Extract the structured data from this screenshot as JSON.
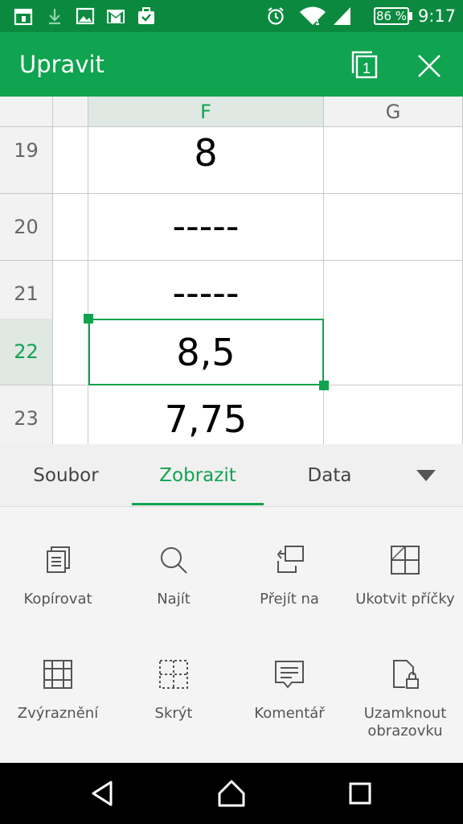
{
  "status_bar": {
    "battery": "86 %",
    "time": "9:17",
    "icons": [
      "calendar-icon",
      "download-icon",
      "image-icon",
      "gmail-icon",
      "briefcase-icon",
      "alarm-icon",
      "wifi-icon",
      "signal-icon",
      "battery-icon"
    ]
  },
  "app_bar": {
    "title": "Upravit",
    "sheet_count": "1",
    "actions": [
      "sheets-icon",
      "close-icon"
    ]
  },
  "sheet": {
    "columns": [
      "",
      "F",
      "G"
    ],
    "active_column": "F",
    "rows": [
      {
        "number": "19",
        "f": "8"
      },
      {
        "number": "20",
        "f": "-----"
      },
      {
        "number": "21",
        "f": "-----"
      },
      {
        "number": "22",
        "f": "8,5"
      },
      {
        "number": "23",
        "f": "7,75"
      }
    ],
    "active_row": "22"
  },
  "tabs": {
    "items": [
      "Soubor",
      "Zobrazit",
      "Data"
    ],
    "active": "Zobrazit"
  },
  "commands": {
    "items": [
      {
        "label": "Kopírovat",
        "icon": "copy-icon"
      },
      {
        "label": "Najít",
        "icon": "search-icon"
      },
      {
        "label": "Přejít na",
        "icon": "goto-icon"
      },
      {
        "label": "Ukotvit příčky",
        "icon": "freeze-panes-icon"
      },
      {
        "label": "Zvýraznění",
        "icon": "highlight-icon"
      },
      {
        "label": "Skrýt",
        "icon": "hide-icon"
      },
      {
        "label": "Komentář",
        "icon": "comment-icon"
      },
      {
        "label": "Uzamknout obrazovku",
        "icon": "lock-screen-icon"
      }
    ]
  },
  "nav_bar": {
    "icons": [
      "back-icon",
      "home-icon",
      "recents-icon"
    ]
  },
  "colors": {
    "status_bar": "#0b8a3f",
    "app_bar": "#10a350",
    "accent": "#10a350"
  }
}
